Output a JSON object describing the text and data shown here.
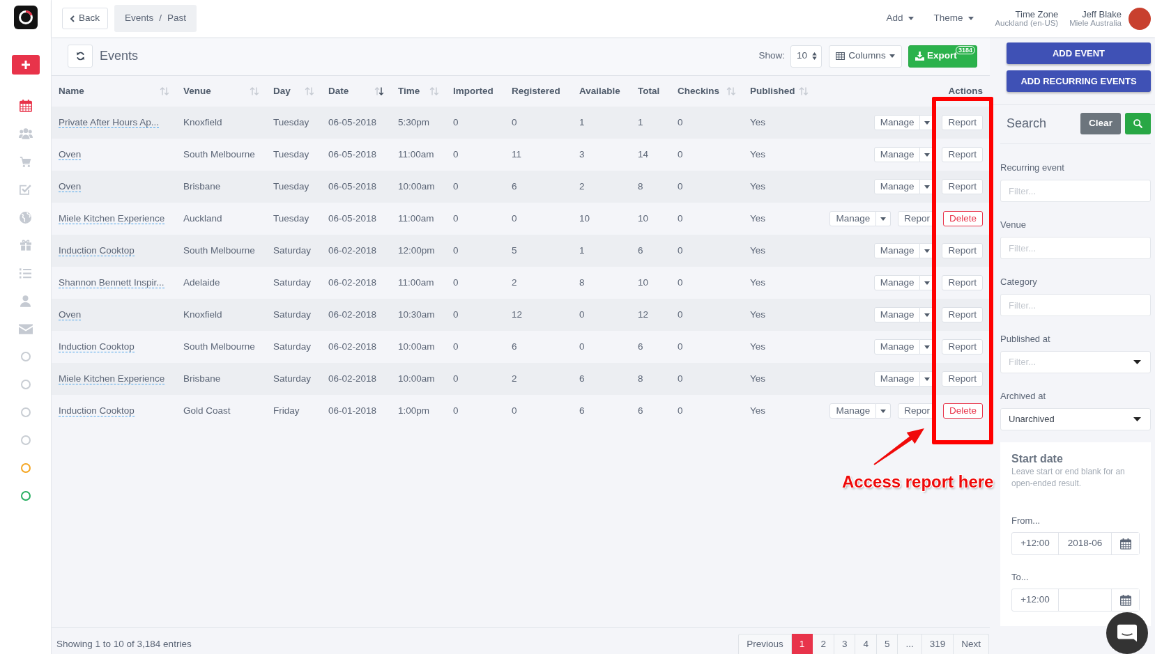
{
  "sidebar": {
    "nav": [
      {
        "selected": true
      },
      {
        "selected": false
      },
      {
        "selected": false
      },
      {
        "selected": false
      },
      {
        "selected": false
      },
      {
        "selected": false
      },
      {
        "selected": false
      },
      {
        "selected": false
      },
      {
        "selected": false
      }
    ],
    "status_rings": [
      {
        "color": "#c8cdd3"
      },
      {
        "color": "#c8cdd3"
      },
      {
        "color": "#c8cdd3"
      },
      {
        "color": "#c8cdd3"
      },
      {
        "color": "#f5a623"
      },
      {
        "color": "#27ae60"
      }
    ]
  },
  "topbar": {
    "back_button": {
      "label": "Back"
    },
    "breadcrumb": {
      "items": [
        {
          "label": "Events"
        },
        {
          "label": "Past"
        }
      ],
      "separator": "/"
    },
    "menus": [
      {
        "label": "Add"
      },
      {
        "label": "Theme"
      }
    ],
    "time_zone": {
      "label": "Time Zone",
      "value": "Auckland (en-US)"
    },
    "user": {
      "name": "Jeff Blake",
      "organization": "Miele Australia"
    }
  },
  "events_panel": {
    "title": "Events",
    "show": {
      "label": "Show:",
      "value": "10"
    },
    "columns_button": {
      "label": "Columns"
    },
    "export_button": {
      "label": "Export",
      "badge": "3184"
    }
  },
  "table": {
    "columns": [
      {
        "label": "Name",
        "sortable": true,
        "sorted": false
      },
      {
        "label": "Venue",
        "sortable": true,
        "sorted": false
      },
      {
        "label": "Day",
        "sortable": true,
        "sorted": false
      },
      {
        "label": "Date",
        "sortable": true,
        "sorted": true
      },
      {
        "label": "Time",
        "sortable": true,
        "sorted": false
      },
      {
        "label": "Imported",
        "sortable": false
      },
      {
        "label": "Registered",
        "sortable": false
      },
      {
        "label": "Available",
        "sortable": false
      },
      {
        "label": "Total",
        "sortable": false
      },
      {
        "label": "Checkins",
        "sortable": true,
        "sorted": false
      },
      {
        "label": "Published",
        "sortable": true,
        "sorted": false
      },
      {
        "label": "Actions",
        "sortable": false
      }
    ],
    "rows": [
      {
        "cells": [
          "Private After Hours Ap...",
          "Knoxfield",
          "Tuesday",
          "06-05-2018",
          "5:30pm",
          "0",
          "0",
          "1",
          "1",
          "0",
          "Yes"
        ],
        "actions": [
          {
            "kind": "manage",
            "label": "Manage"
          },
          {
            "kind": "report",
            "label": "Report"
          }
        ]
      },
      {
        "cells": [
          "Oven",
          "South Melbourne",
          "Tuesday",
          "06-05-2018",
          "11:00am",
          "0",
          "11",
          "3",
          "14",
          "0",
          "Yes"
        ],
        "actions": [
          {
            "kind": "manage",
            "label": "Manage"
          },
          {
            "kind": "report",
            "label": "Report"
          }
        ]
      },
      {
        "cells": [
          "Oven",
          "Brisbane",
          "Tuesday",
          "06-05-2018",
          "10:00am",
          "0",
          "6",
          "2",
          "8",
          "0",
          "Yes"
        ],
        "actions": [
          {
            "kind": "manage",
            "label": "Manage"
          },
          {
            "kind": "report",
            "label": "Report"
          }
        ]
      },
      {
        "cells": [
          "Miele Kitchen Experience",
          "Auckland",
          "Tuesday",
          "06-05-2018",
          "11:00am",
          "0",
          "0",
          "10",
          "10",
          "0",
          "Yes"
        ],
        "actions": [
          {
            "kind": "manage",
            "label": "Manage"
          },
          {
            "kind": "report",
            "label": "Repor"
          },
          {
            "kind": "delete",
            "label": "Delete"
          }
        ]
      },
      {
        "cells": [
          "Induction Cooktop",
          "South Melbourne",
          "Saturday",
          "06-02-2018",
          "12:00pm",
          "0",
          "5",
          "1",
          "6",
          "0",
          "Yes"
        ],
        "actions": [
          {
            "kind": "manage",
            "label": "Manage"
          },
          {
            "kind": "report",
            "label": "Report"
          }
        ]
      },
      {
        "cells": [
          "Shannon Bennett Inspir...",
          "Adelaide",
          "Saturday",
          "06-02-2018",
          "11:00am",
          "0",
          "2",
          "8",
          "10",
          "0",
          "Yes"
        ],
        "actions": [
          {
            "kind": "manage",
            "label": "Manage"
          },
          {
            "kind": "report",
            "label": "Report"
          }
        ]
      },
      {
        "cells": [
          "Oven",
          "Knoxfield",
          "Saturday",
          "06-02-2018",
          "10:30am",
          "0",
          "12",
          "0",
          "12",
          "0",
          "Yes"
        ],
        "actions": [
          {
            "kind": "manage",
            "label": "Manage"
          },
          {
            "kind": "report",
            "label": "Report"
          }
        ]
      },
      {
        "cells": [
          "Induction Cooktop",
          "South Melbourne",
          "Saturday",
          "06-02-2018",
          "10:00am",
          "0",
          "6",
          "0",
          "6",
          "0",
          "Yes"
        ],
        "actions": [
          {
            "kind": "manage",
            "label": "Manage"
          },
          {
            "kind": "report",
            "label": "Report"
          }
        ]
      },
      {
        "cells": [
          "Miele Kitchen Experience",
          "Brisbane",
          "Saturday",
          "06-02-2018",
          "10:00am",
          "0",
          "2",
          "6",
          "8",
          "0",
          "Yes"
        ],
        "actions": [
          {
            "kind": "manage",
            "label": "Manage"
          },
          {
            "kind": "report",
            "label": "Report"
          }
        ]
      },
      {
        "cells": [
          "Induction Cooktop",
          "Gold Coast",
          "Friday",
          "06-01-2018",
          "1:00pm",
          "0",
          "0",
          "6",
          "6",
          "0",
          "Yes"
        ],
        "actions": [
          {
            "kind": "manage",
            "label": "Manage"
          },
          {
            "kind": "report",
            "label": "Repor"
          },
          {
            "kind": "delete",
            "label": "Delete"
          }
        ]
      }
    ]
  },
  "footer": {
    "summary": "Showing 1 to 10 of 3,184 entries",
    "pagination": [
      {
        "label": "Previous",
        "selected": false
      },
      {
        "label": "1",
        "selected": true
      },
      {
        "label": "2",
        "selected": false
      },
      {
        "label": "3",
        "selected": false
      },
      {
        "label": "4",
        "selected": false
      },
      {
        "label": "5",
        "selected": false
      },
      {
        "label": "...",
        "selected": false
      },
      {
        "label": "319",
        "selected": false
      },
      {
        "label": "Next",
        "selected": false
      }
    ]
  },
  "filters_panel": {
    "buttons": [
      {
        "label": "ADD EVENT"
      },
      {
        "label": "ADD RECURRING EVENTS"
      }
    ],
    "search": {
      "title": "Search",
      "clear_label": "Clear"
    },
    "filters": [
      {
        "kind": "input",
        "label": "Recurring event",
        "placeholder": "Filter..."
      },
      {
        "kind": "input",
        "label": "Venue",
        "placeholder": "Filter..."
      },
      {
        "kind": "input",
        "label": "Category",
        "placeholder": "Filter..."
      },
      {
        "kind": "select",
        "label": "Published at",
        "placeholder": "Filter..."
      },
      {
        "kind": "select",
        "label": "Archived at",
        "value": "Unarchived"
      }
    ],
    "start_date": {
      "title": "Start date",
      "help": "Leave start or end blank for an open-ended result.",
      "ranges": [
        {
          "label": "From...",
          "offset": "+12:00",
          "value": "2018-06"
        },
        {
          "label": "To...",
          "offset": "+12:00"
        }
      ]
    }
  },
  "annotation": {
    "text": "Access report here"
  }
}
